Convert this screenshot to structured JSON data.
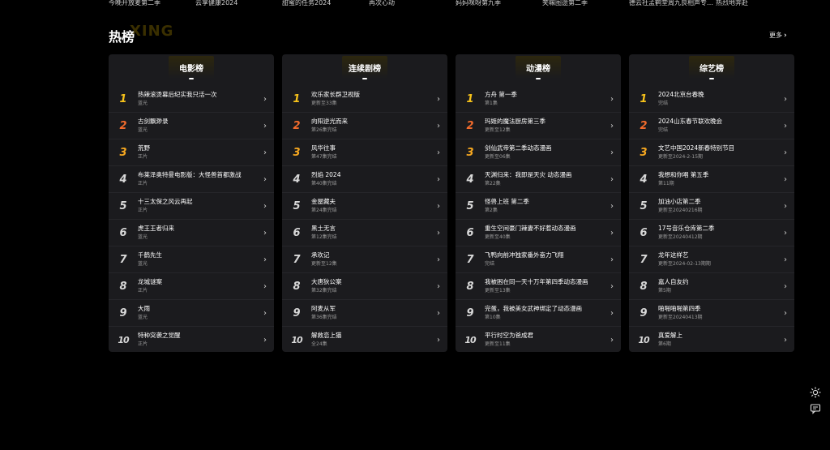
{
  "top_strip": [
    "今晚开放麦第二季",
    "云享健康2024",
    "甜蜜的任务2024",
    "再次心动",
    "妈妈咪呀第九季",
    "笑嘛图途第二季",
    "德云社孟鹤堂周九良相声专…",
    "热烈地奔赴"
  ],
  "section": {
    "title": "热榜",
    "watermark": "XING",
    "more": "更多"
  },
  "cards": [
    {
      "title": "电影榜",
      "items": [
        {
          "rank": "1",
          "name": "热辣滚烫幕后纪实我只活一次",
          "sub": "蓝光"
        },
        {
          "rank": "2",
          "name": "古剑飘渺录",
          "sub": "蓝光"
        },
        {
          "rank": "3",
          "name": "荒野",
          "sub": "正片"
        },
        {
          "rank": "4",
          "name": "布莱泽奥特曼电影版：大怪兽首都激战",
          "sub": "正片"
        },
        {
          "rank": "5",
          "name": "十三太保之风云再起",
          "sub": "正片"
        },
        {
          "rank": "6",
          "name": "虎王王者归来",
          "sub": "蓝光"
        },
        {
          "rank": "7",
          "name": "千鹤先生",
          "sub": "蓝光"
        },
        {
          "rank": "8",
          "name": "龙城谜案",
          "sub": "正片"
        },
        {
          "rank": "9",
          "name": "大雨",
          "sub": "蓝光"
        },
        {
          "rank": "10",
          "name": "特种突袭之觉醒",
          "sub": "正片"
        }
      ]
    },
    {
      "title": "连续剧榜",
      "items": [
        {
          "rank": "1",
          "name": "欢乐家长群卫视版",
          "sub": "更新至33集"
        },
        {
          "rank": "2",
          "name": "向阳逆光而来",
          "sub": "第26集完结"
        },
        {
          "rank": "3",
          "name": "风华往事",
          "sub": "第47集完结"
        },
        {
          "rank": "4",
          "name": "烈焰 2024",
          "sub": "第40集完结"
        },
        {
          "rank": "5",
          "name": "金屋藏夫",
          "sub": "第24集完结"
        },
        {
          "rank": "6",
          "name": "黑土无言",
          "sub": "第12集完结"
        },
        {
          "rank": "7",
          "name": "承欢记",
          "sub": "更新至12集"
        },
        {
          "rank": "8",
          "name": "大唐狄公案",
          "sub": "第32集完结"
        },
        {
          "rank": "9",
          "name": "阿麦从军",
          "sub": "第36集完结"
        },
        {
          "rank": "10",
          "name": "解救恋上猫",
          "sub": "全24集"
        }
      ]
    },
    {
      "title": "动漫榜",
      "items": [
        {
          "rank": "1",
          "name": "方舟 第一季",
          "sub": "第1集"
        },
        {
          "rank": "2",
          "name": "玛姬的魔法厨房第三季",
          "sub": "更新至12集"
        },
        {
          "rank": "3",
          "name": "剑仙武帝第二季动态漫画",
          "sub": "更新至06集"
        },
        {
          "rank": "4",
          "name": "天渊归来：我即是天灾 动态漫画",
          "sub": "第22集"
        },
        {
          "rank": "5",
          "name": "怪兽上班 第二季",
          "sub": "第2集"
        },
        {
          "rank": "6",
          "name": "重生空间豪门辣妻不好惹动态漫画",
          "sub": "更新至40集"
        },
        {
          "rank": "7",
          "name": "飞鸭向前冲独家番外奋力飞翔",
          "sub": "完结"
        },
        {
          "rank": "8",
          "name": "我被困在同一天十万年第四季动态漫画",
          "sub": "更新至13集"
        },
        {
          "rank": "9",
          "name": "完蛋，我被美女武神绑定了动态漫画",
          "sub": "第10集"
        },
        {
          "rank": "10",
          "name": "平行时空为爸成君",
          "sub": "更新至11集"
        }
      ]
    },
    {
      "title": "综艺榜",
      "items": [
        {
          "rank": "1",
          "name": "2024北京台春晚",
          "sub": "完结"
        },
        {
          "rank": "2",
          "name": "2024山东春节联欢晚会",
          "sub": "完结"
        },
        {
          "rank": "3",
          "name": "文艺中国2024新春特别节目",
          "sub": "更新至2024-2-15期"
        },
        {
          "rank": "4",
          "name": "我想和你唱 第五季",
          "sub": "第11期"
        },
        {
          "rank": "5",
          "name": "加油小店第二季",
          "sub": "更新至20240216期"
        },
        {
          "rank": "6",
          "name": "17号音乐仓库第二季",
          "sub": "更新至20240412期"
        },
        {
          "rank": "7",
          "name": "龙年这样艺",
          "sub": "更新至2024-02-13期期"
        },
        {
          "rank": "8",
          "name": "嘉人自友约",
          "sub": "第5期"
        },
        {
          "rank": "9",
          "name": "啪啪啪啪第四季",
          "sub": "更新至20240413期"
        },
        {
          "rank": "10",
          "name": "真爱解上",
          "sub": "第6期"
        }
      ]
    }
  ],
  "side_icons": [
    "sun-icon",
    "feedback-icon"
  ],
  "colors": {
    "rank1": "#f7c21a",
    "rank2": "#f26b2c",
    "rank3": "#f7a820",
    "card_bg": "#1b1b1e"
  }
}
